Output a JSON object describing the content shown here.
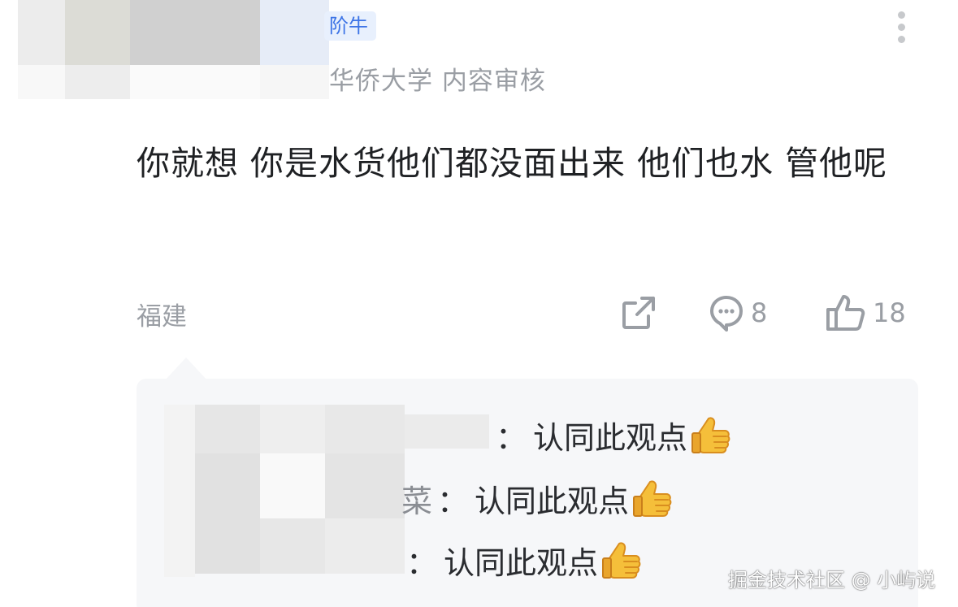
{
  "header": {
    "badge_label": "阶牛",
    "author_description": "华侨大学 内容审核",
    "more_icon": "more-vertical-icon"
  },
  "comment": {
    "text": "你就想 你是水货他们都没面出来  他们也水  管他呢",
    "location": "福建"
  },
  "actions": {
    "share_icon": "share-icon",
    "reply_icon": "comment-icon",
    "reply_count": "8",
    "like_icon": "thumbs-up-icon",
    "like_count": "18"
  },
  "replies": [
    {
      "name_fragment": "",
      "text": "认同此观点",
      "emoji": "thumbs-up-emoji"
    },
    {
      "name_fragment": "菜",
      "text": "认同此观点",
      "emoji": "thumbs-up-emoji"
    },
    {
      "name_fragment": "",
      "text": "认同此观点",
      "emoji": "thumbs-up-emoji"
    }
  ],
  "reply_colon": "：",
  "watermark": "掘金技术社区 @ 小屿说",
  "colors": {
    "badge_bg": "#e8f0fd",
    "badge_text": "#3d74e6",
    "secondary_text": "#9a9ea4",
    "primary_text": "#1f2124",
    "reply_bg": "#f6f7f9"
  }
}
